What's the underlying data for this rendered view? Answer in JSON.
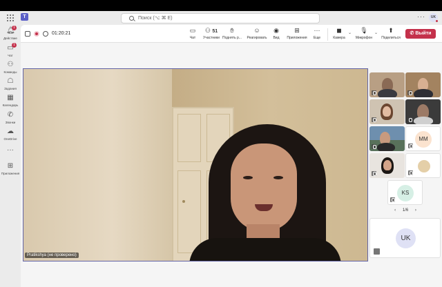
{
  "search": {
    "placeholder": "Поиск (⌥ ⌘ E)"
  },
  "topbar": {
    "more": "···",
    "user_initials": "UK"
  },
  "rail": {
    "items": [
      {
        "label": "Действие",
        "badge": "1"
      },
      {
        "label": "Чат",
        "badge": "1"
      },
      {
        "label": "Команды",
        "badge": ""
      },
      {
        "label": "Задания",
        "badge": ""
      },
      {
        "label": "Календарь",
        "badge": ""
      },
      {
        "label": "Звонки",
        "badge": ""
      },
      {
        "label": "OneDrive",
        "badge": ""
      },
      {
        "label": "···",
        "badge": ""
      },
      {
        "label": "Приложения",
        "badge": ""
      }
    ]
  },
  "meeting": {
    "timer": "01:20:21",
    "toolbar": {
      "chat": "Чат",
      "participants": "Участники",
      "participants_count": "51",
      "raise_hand": "Поднять р...",
      "react": "Реагировать",
      "view": "Вид",
      "apps": "Приложения",
      "more": "Еще",
      "camera": "Камера",
      "mic": "Микрофон",
      "share": "Поделиться",
      "leave": "Выйти"
    },
    "speaker_name": "Pratikshya (не проверено)",
    "tiles": [
      {
        "initials": ""
      },
      {
        "initials": ""
      },
      {
        "initials": ""
      },
      {
        "initials": ""
      },
      {
        "initials": ""
      },
      {
        "initials": "MM"
      },
      {
        "initials": ""
      },
      {
        "initials": ""
      },
      {
        "initials": "KS"
      }
    ],
    "pager": {
      "prev": "‹",
      "page": "1/6",
      "next": "›"
    },
    "self_initials": "UK"
  },
  "colors": {
    "accent": "#5b5fc7",
    "leave": "#c4314b",
    "stage_border": "#6264a7"
  }
}
